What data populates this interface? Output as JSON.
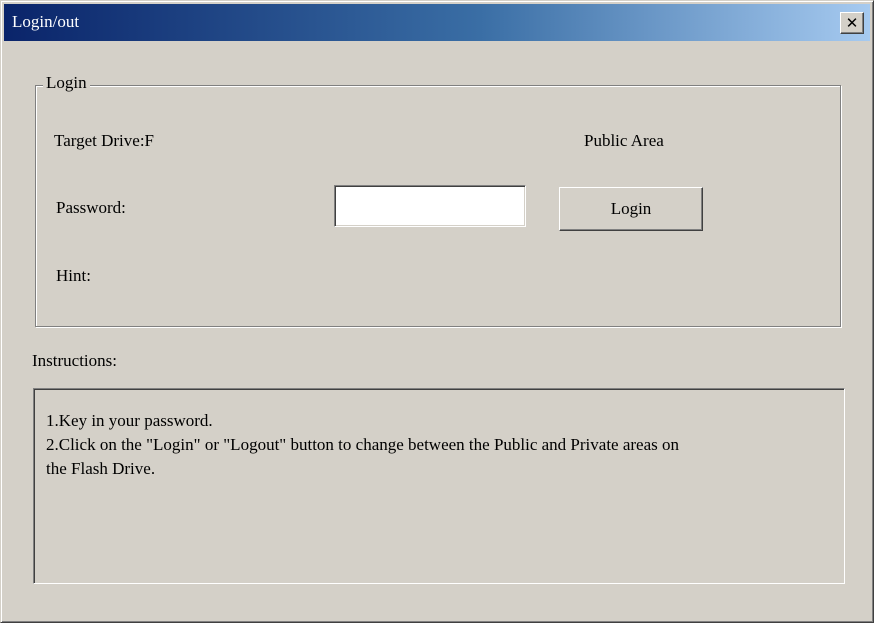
{
  "window": {
    "title": "Login/out",
    "close_glyph": "✕"
  },
  "login_group": {
    "legend": "Login",
    "target_drive_label": "Target Drive:F",
    "area_status": "Public Area",
    "password_label": "Password:",
    "password_value": "",
    "password_placeholder": "",
    "login_button_label": "Login",
    "hint_label": "Hint:"
  },
  "instructions": {
    "label": "Instructions:",
    "lines": [
      "1.Key in your password.",
      "2.Click on the \"Login\" or \"Logout\" button to change between the Public and Private areas on",
      "the Flash Drive."
    ]
  },
  "colors": {
    "face": "#d4d0c8",
    "title_start": "#0a246a",
    "title_end": "#a6caf0"
  },
  "icons": {
    "close": "close-icon"
  }
}
